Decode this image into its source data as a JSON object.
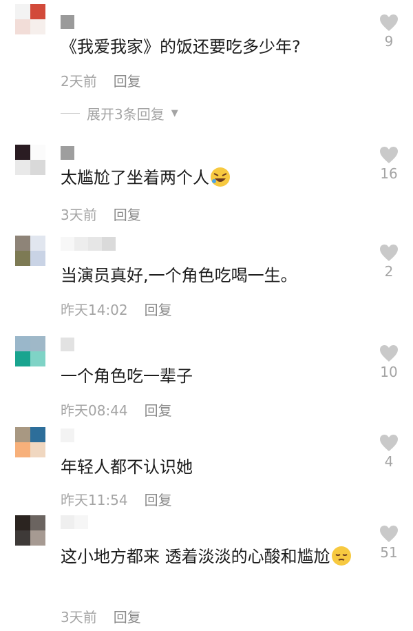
{
  "comments": [
    {
      "text": "《我爱我家》的饭还要吃多少年?",
      "time": "2天前",
      "reply": "回复",
      "likes": "9",
      "avatar_colors": [
        "#f3f3f3",
        "#d24a3a",
        "#f2ddd8",
        "#f6efec"
      ],
      "name_blocks": [
        "#9a9a9a"
      ],
      "expand": "展开3条回复"
    },
    {
      "text": "太尴尬了坐着两个人",
      "emoji": "rolling-laughing-emoji",
      "time": "3天前",
      "reply": "回复",
      "likes": "16",
      "avatar_colors": [
        "#2a1c22",
        "#fbfbfb",
        "#e9e9e9",
        "#d9d9d9"
      ],
      "name_blocks": [
        "#9e9e9e"
      ]
    },
    {
      "text": "当演员真好,一个角色吃喝一生。",
      "time": "昨天14:02",
      "reply": "回复",
      "likes": "2",
      "avatar_colors": [
        "#8e8478",
        "#e1e6ef",
        "#7d7a54",
        "#c9d3e5"
      ],
      "name_blocks": [
        "#f7f7f7",
        "#ededed",
        "#e6e6e6",
        "#dadada"
      ]
    },
    {
      "text": "一个角色吃一辈子",
      "time": "昨天08:44",
      "reply": "回复",
      "likes": "10",
      "avatar_colors": [
        "#9ab7ca",
        "#9fb8c8",
        "#19a48f",
        "#7fd3c6"
      ],
      "name_blocks": [
        "#e2e2e2"
      ]
    },
    {
      "text": "年轻人都不认识她",
      "time": "昨天11:54",
      "reply": "回复",
      "likes": "4",
      "avatar_colors": [
        "#a89882",
        "#2d6e9a",
        "#f7b07a",
        "#f0d7c0"
      ],
      "name_blocks": [
        "#f3f3f3"
      ]
    },
    {
      "text": "这小地方都来 透着淡淡的心酸和尴尬",
      "emoji": "pensive-emoji",
      "time": "3天前",
      "reply": "回复",
      "likes": "51",
      "avatar_colors": [
        "#2b2420",
        "#6b6460",
        "#3e3a38",
        "#a69a92"
      ],
      "name_blocks": [
        "#efefef",
        "#f6f6f6"
      ]
    }
  ]
}
